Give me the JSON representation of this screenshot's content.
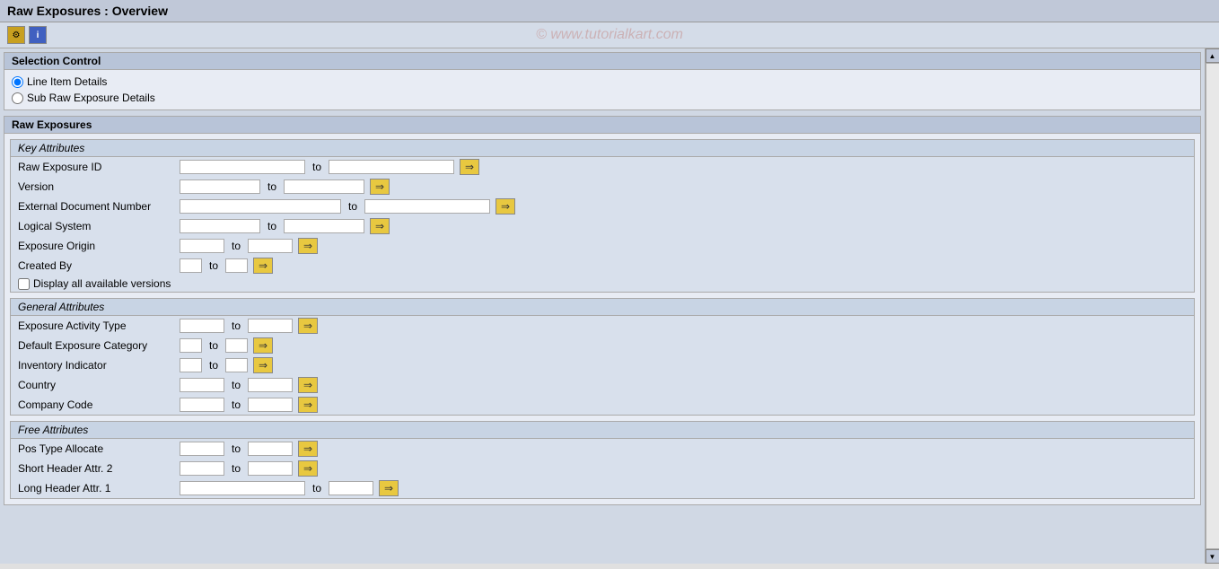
{
  "titleBar": {
    "title": "Raw Exposures : Overview"
  },
  "toolbar": {
    "watermark": "© www.tutorialkart.com",
    "icons": [
      "settings-icon",
      "info-icon"
    ]
  },
  "selectionControl": {
    "sectionTitle": "Selection Control",
    "options": [
      {
        "label": "Line Item Details",
        "selected": true
      },
      {
        "label": "Sub Raw Exposure Details",
        "selected": false
      }
    ]
  },
  "rawExposures": {
    "sectionTitle": "Raw Exposures",
    "keyAttributes": {
      "title": "Key Attributes",
      "fields": [
        {
          "label": "Raw Exposure ID",
          "inputSize": "large",
          "inputSize2": "large"
        },
        {
          "label": "Version",
          "inputSize": "medium",
          "inputSize2": "medium"
        },
        {
          "label": "External Document Number",
          "inputSize": "xlarge",
          "inputSize2": "large"
        },
        {
          "label": "Logical System",
          "inputSize": "medium",
          "inputSize2": "medium"
        },
        {
          "label": "Exposure Origin",
          "inputSize": "small",
          "inputSize2": "small"
        },
        {
          "label": "Created By",
          "inputSize": "tiny",
          "inputSize2": "tiny"
        }
      ],
      "checkbox": {
        "label": "Display all available versions"
      }
    },
    "generalAttributes": {
      "title": "General Attributes",
      "fields": [
        {
          "label": "Exposure Activity Type",
          "inputSize": "small",
          "inputSize2": "small"
        },
        {
          "label": "Default Exposure Category",
          "inputSize": "tiny",
          "inputSize2": "tiny"
        },
        {
          "label": "Inventory Indicator",
          "inputSize": "tiny",
          "inputSize2": "tiny"
        },
        {
          "label": "Country",
          "inputSize": "small",
          "inputSize2": "small"
        },
        {
          "label": "Company Code",
          "inputSize": "small",
          "inputSize2": "small"
        }
      ]
    },
    "freeAttributes": {
      "title": "Free Attributes",
      "fields": [
        {
          "label": "Pos Type Allocate",
          "inputSize": "small",
          "inputSize2": "small"
        },
        {
          "label": "Short Header Attr. 2",
          "inputSize": "small",
          "inputSize2": "small"
        },
        {
          "label": "Long Header Attr. 1",
          "inputSize": "large",
          "inputSize2": "small"
        }
      ]
    }
  }
}
